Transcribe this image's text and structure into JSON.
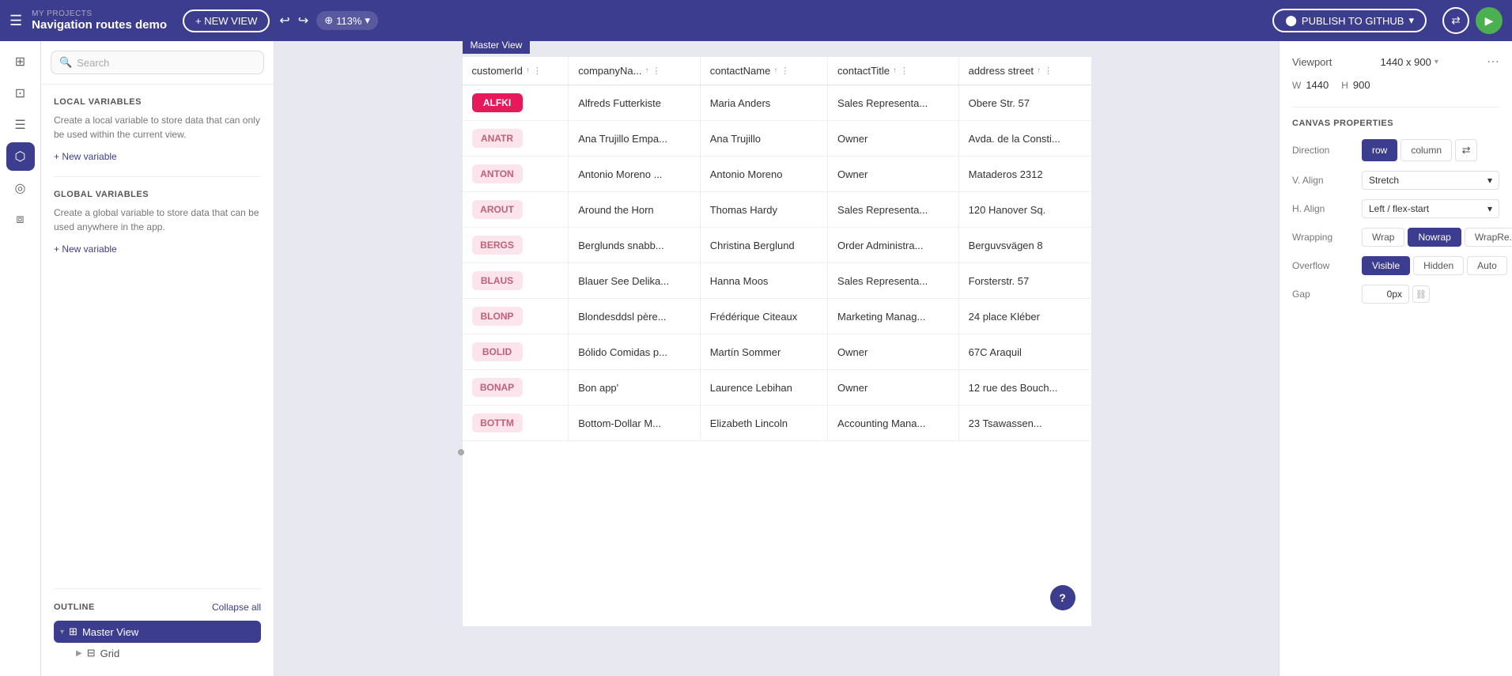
{
  "topbar": {
    "my_projects_label": "MY PROJECTS",
    "project_name": "Navigation routes demo",
    "new_view_btn": "+ NEW VIEW",
    "zoom_level": "113%",
    "publish_btn": "PUBLISH TO GITHUB"
  },
  "search": {
    "placeholder": "Search"
  },
  "master_view_label": "Master View",
  "outline_label": "Master View",
  "outline_title": "OUTLINE",
  "collapse_all": "Collapse all",
  "grid_label": "Grid",
  "local_variables": {
    "title": "LOCAL VARIABLES",
    "description": "Create a local variable to store data that can only be used within the current view.",
    "new_variable_link": "+ New variable"
  },
  "global_variables": {
    "title": "GLOBAL VARIABLES",
    "description": "Create a global variable to store data that can be used anywhere in the app.",
    "new_variable_link": "+ New variable"
  },
  "canvas_properties": {
    "title": "CANVAS PROPERTIES",
    "viewport_label": "Viewport",
    "viewport_value": "1440 x 900",
    "w_label": "W",
    "w_value": "1440",
    "h_label": "H",
    "h_value": "900",
    "direction_label": "Direction",
    "direction_row": "row",
    "direction_column": "column",
    "v_align_label": "V. Align",
    "v_align_value": "Stretch",
    "h_align_label": "H. Align",
    "h_align_value": "Left / flex-start",
    "wrapping_label": "Wrapping",
    "wrap_btn": "Wrap",
    "nowrap_btn": "Nowrap",
    "wrapre_btn": "WrapRe...",
    "overflow_label": "Overflow",
    "visible_btn": "Visible",
    "hidden_btn": "Hidden",
    "auto_btn": "Auto",
    "gap_label": "Gap",
    "gap_value": "0px"
  },
  "table": {
    "columns": [
      {
        "key": "customerId",
        "label": "customerId"
      },
      {
        "key": "companyName",
        "label": "companyNa..."
      },
      {
        "key": "contactName",
        "label": "contactName"
      },
      {
        "key": "contactTitle",
        "label": "contactTitle"
      },
      {
        "key": "addressStreet",
        "label": "address street"
      }
    ],
    "rows": [
      {
        "customerId": "ALFKI",
        "active": true,
        "companyName": "Alfreds Futterkiste",
        "contactName": "Maria Anders",
        "contactTitle": "Sales Representa...",
        "addressStreet": "Obere Str. 57"
      },
      {
        "customerId": "ANATR",
        "active": false,
        "companyName": "Ana Trujillo Empa...",
        "contactName": "Ana Trujillo",
        "contactTitle": "Owner",
        "addressStreet": "Avda. de la Consti..."
      },
      {
        "customerId": "ANTON",
        "active": false,
        "companyName": "Antonio Moreno ...",
        "contactName": "Antonio Moreno",
        "contactTitle": "Owner",
        "addressStreet": "Mataderos 2312"
      },
      {
        "customerId": "AROUT",
        "active": false,
        "companyName": "Around the Horn",
        "contactName": "Thomas Hardy",
        "contactTitle": "Sales Representa...",
        "addressStreet": "120 Hanover Sq."
      },
      {
        "customerId": "BERGS",
        "active": false,
        "companyName": "Berglunds snabb...",
        "contactName": "Christina Berglund",
        "contactTitle": "Order Administra...",
        "addressStreet": "Berguvsvägen 8"
      },
      {
        "customerId": "BLAUS",
        "active": false,
        "companyName": "Blauer See Delika...",
        "contactName": "Hanna Moos",
        "contactTitle": "Sales Representa...",
        "addressStreet": "Forsterstr. 57"
      },
      {
        "customerId": "BLONP",
        "active": false,
        "companyName": "Blondesddsl père...",
        "contactName": "Frédérique Citeaux",
        "contactTitle": "Marketing Manag...",
        "addressStreet": "24 place Kléber"
      },
      {
        "customerId": "BOLID",
        "active": false,
        "companyName": "Bólido Comidas p...",
        "contactName": "Martín Sommer",
        "contactTitle": "Owner",
        "addressStreet": "67C Araquil"
      },
      {
        "customerId": "BONAP",
        "active": false,
        "companyName": "Bon app'",
        "contactName": "Laurence Lebihan",
        "contactTitle": "Owner",
        "addressStreet": "12 rue des Bouch..."
      },
      {
        "customerId": "BOTTM",
        "active": false,
        "companyName": "Bottom-Dollar M...",
        "contactName": "Elizabeth Lincoln",
        "contactTitle": "Accounting Mana...",
        "addressStreet": "23 Tsawassen..."
      }
    ]
  }
}
